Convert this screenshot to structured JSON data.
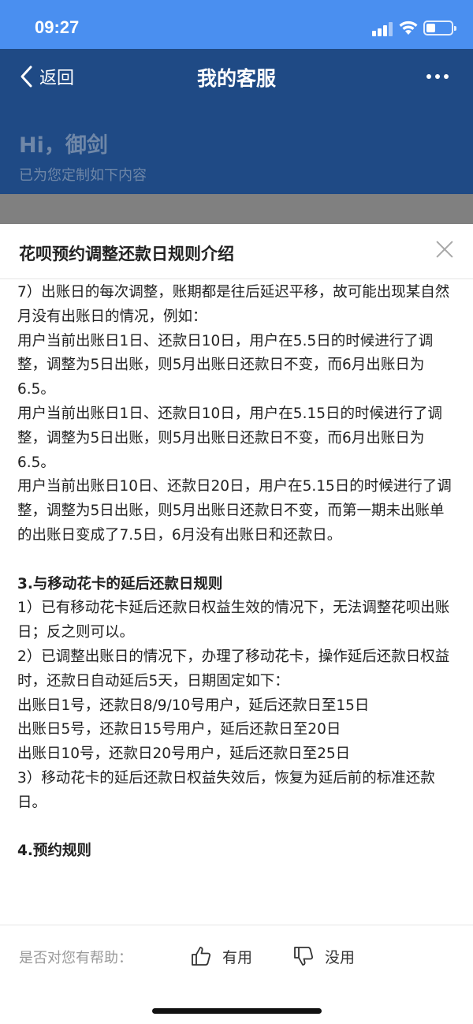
{
  "status_bar": {
    "time": "09:27"
  },
  "nav": {
    "back_label": "返回",
    "title": "我的客服"
  },
  "greeting": {
    "title": "Hi，御剑",
    "subtitle": "已为您定制如下内容"
  },
  "sheet": {
    "title": "花呗预约调整还款日规则介绍",
    "lines": [
      "7）出账日的每次调整，账期都是往后延迟平移，故可能出现某自然月没有出账日的情况，例如：",
      "用户当前出账日1日、还款日10日，用户在5.5日的时候进行了调整，调整为5日出账，则5月出账日还款日不变，而6月出账日为6.5。",
      "用户当前出账日1日、还款日10日，用户在5.15日的时候进行了调整，调整为5日出账，则5月出账日还款日不变，而6月出账日为6.5。",
      "用户当前出账日10日、还款日20日，用户在5.15日的时候进行了调整，调整为5日出账，则5月出账日还款日不变，而第一期未出账单的出账日变成了7.5日，6月没有出账日和还款日。"
    ],
    "section_title": "3.与移动花卡的延后还款日规则",
    "section_lines": [
      "1）已有移动花卡延后还款日权益生效的情况下，无法调整花呗出账日；反之则可以。",
      "2）已调整出账日的情况下，办理了移动花卡，操作延后还款日权益时，还款日自动延后5天，日期固定如下：",
      "出账日1号，还款日8/9/10号用户，延后还款日至15日",
      "出账日5号，还款日15号用户，延后还款日至20日",
      "出账日10号，还款日20号用户，延后还款日至25日",
      "3）移动花卡的延后还款日权益失效后，恢复为延后前的标准还款日。"
    ],
    "next_section_title": "4.预约规则"
  },
  "feedback": {
    "question": "是否对您有帮助：",
    "useful_label": "有用",
    "useless_label": "没用"
  }
}
